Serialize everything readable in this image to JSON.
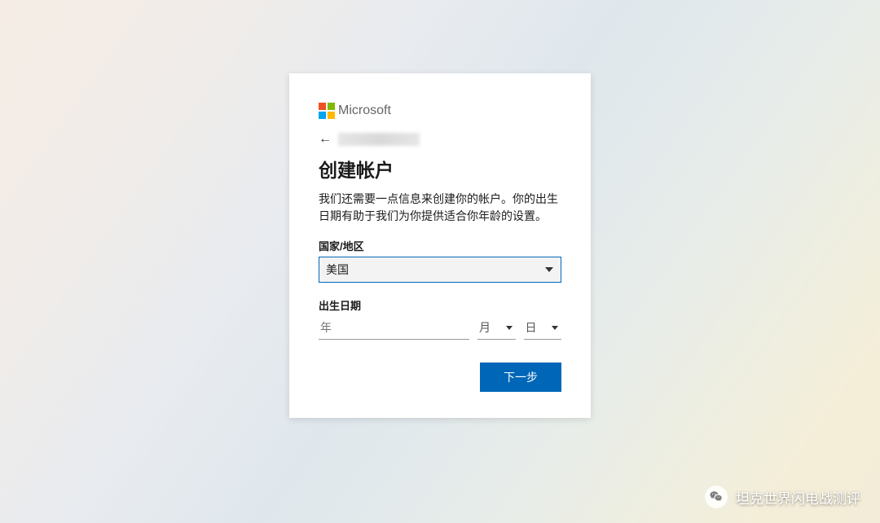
{
  "brand": "Microsoft",
  "form": {
    "title": "创建帐户",
    "description": "我们还需要一点信息来创建你的帐户。你的出生日期有助于我们为你提供适合你年龄的设置。",
    "country": {
      "label": "国家/地区",
      "value": "美国"
    },
    "dob": {
      "label": "出生日期",
      "year_placeholder": "年",
      "month_placeholder": "月",
      "day_placeholder": "日"
    },
    "next_button": "下一步"
  },
  "watermark": {
    "text": "坦克世界闪电战测评"
  }
}
